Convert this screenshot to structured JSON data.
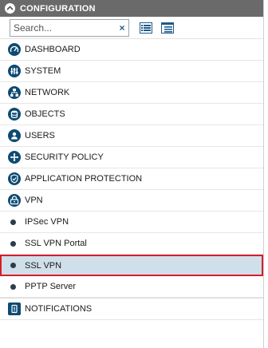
{
  "header": {
    "title": "CONFIGURATION"
  },
  "search": {
    "placeholder": "Search...",
    "clear_label": "×"
  },
  "menu": [
    {
      "label": "DASHBOARD",
      "icon": "dashboard-icon"
    },
    {
      "label": "SYSTEM",
      "icon": "system-icon"
    },
    {
      "label": "NETWORK",
      "icon": "network-icon"
    },
    {
      "label": "OBJECTS",
      "icon": "objects-icon"
    },
    {
      "label": "USERS",
      "icon": "users-icon"
    },
    {
      "label": "SECURITY POLICY",
      "icon": "security-policy-icon"
    },
    {
      "label": "APPLICATION PROTECTION",
      "icon": "application-protection-icon"
    },
    {
      "label": "VPN",
      "icon": "vpn-icon"
    }
  ],
  "vpn_items": [
    {
      "label": "IPSec VPN"
    },
    {
      "label": "SSL VPN Portal"
    },
    {
      "label": "SSL VPN",
      "selected": true
    },
    {
      "label": "PPTP Server"
    }
  ],
  "notifications": {
    "label": "NOTIFICATIONS",
    "icon": "notifications-icon"
  },
  "colors": {
    "header_bg": "#6a6a6a",
    "icon_bg": "#0d4a73",
    "selected_bg": "#cfe0ea",
    "selected_border": "#d51e2a"
  }
}
